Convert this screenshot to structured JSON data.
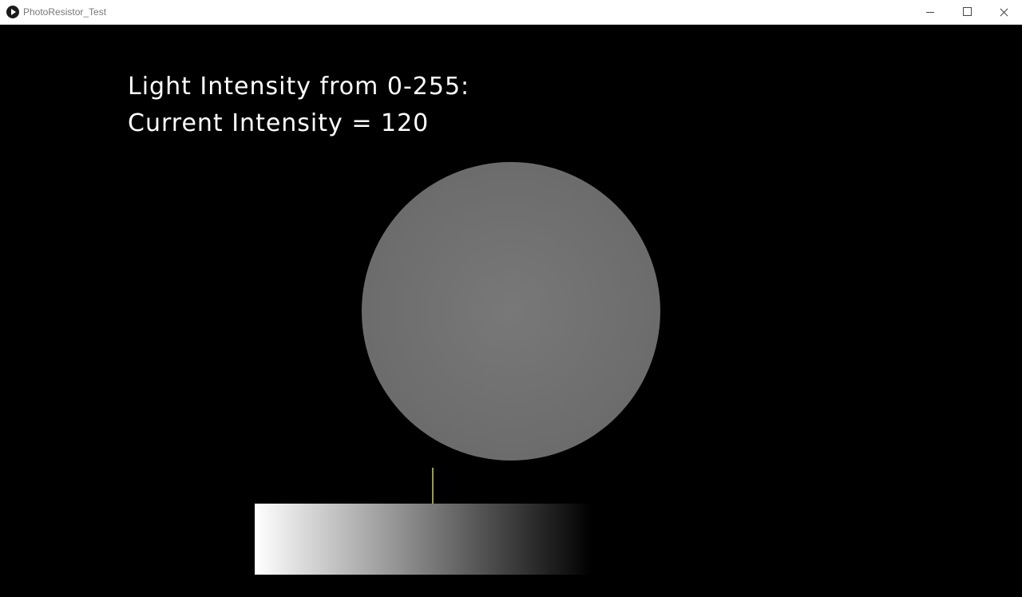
{
  "window": {
    "title": "PhotoResistor_Test",
    "app_icon": "play-circle-icon",
    "controls": [
      "minimize-icon",
      "maximize-icon",
      "close-icon"
    ]
  },
  "sketch": {
    "heading": "Light Intensity from 0-255:",
    "current_text": "Current Intensity = 120",
    "intensity": 120,
    "intensity_min": 0,
    "intensity_max": 255,
    "background_color": "#000000",
    "text_color": "#ffffff",
    "indicator_color": "#9a9a5a"
  }
}
